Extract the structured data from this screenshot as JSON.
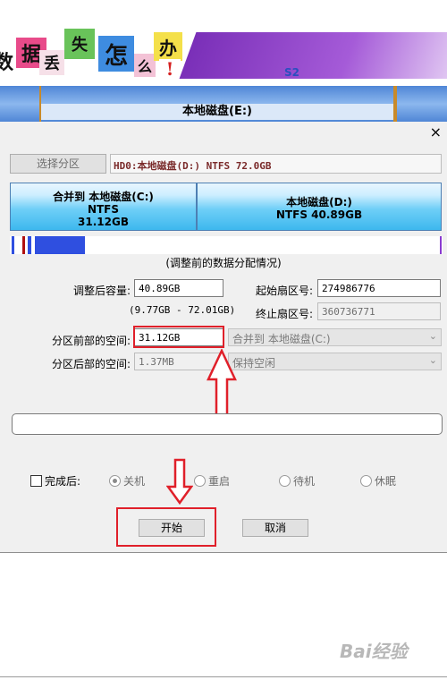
{
  "banner": {
    "tiles": [
      "数",
      "据",
      "丢",
      "失",
      "怎",
      "么",
      "办",
      "!"
    ],
    "phone_partial": "S2"
  },
  "strip": {
    "disk_title": "本地磁盘(E:)"
  },
  "dialog": {
    "close_glyph": "×",
    "select_partition_label": "选择分区",
    "hdd_info": "HD0:本地磁盘(D:) NTFS 72.0GB",
    "disk_c": {
      "line1": "合并到 本地磁盘(C:)",
      "line2": "NTFS",
      "line3": "31.12GB"
    },
    "disk_d": {
      "line1": "本地磁盘(D:)",
      "line2": "NTFS 40.89GB"
    },
    "data_distribution_caption": "(调整前的数据分配情况)",
    "size_after_label": "调整后容量:",
    "size_after_value": "40.89GB",
    "size_range": "(9.77GB - 72.01GB)",
    "start_sector_label": "起始扇区号:",
    "start_sector_value": "274986776",
    "end_sector_label": "终止扇区号:",
    "end_sector_value": "360736771",
    "front_space_label": "分区前部的空间:",
    "front_space_value": "31.12GB",
    "front_space_action": "合并到 本地磁盘(C:)",
    "rear_space_label": "分区后部的空间:",
    "rear_space_value": "1.37MB",
    "rear_space_action": "保持空闲",
    "after_done_label": "完成后:",
    "radio_shutdown": "关机",
    "radio_restart": "重启",
    "radio_standby": "待机",
    "radio_hibernate": "休眠",
    "start_button": "开始",
    "cancel_button": "取消"
  },
  "colors": {
    "annotation_red": "#e0202a",
    "disk_blue": "#3db8ee",
    "bar_blue": "#2f4fe0"
  },
  "watermark": "Bai经验"
}
